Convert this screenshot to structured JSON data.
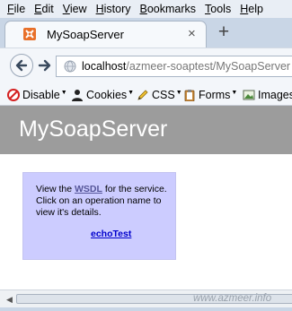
{
  "menu": {
    "file_rest": "ile",
    "edit_rest": "dit",
    "view_rest": "iew",
    "history_rest": "istory",
    "bookmarks_rest": "ookmarks",
    "tools_rest": "ools",
    "help_rest": "elp"
  },
  "tab": {
    "title": "MySoapServer",
    "close_glyph": "×"
  },
  "newtab_glyph": "+",
  "address": {
    "host": "localhost",
    "path": "/azmeer-soaptest/MySoapServer"
  },
  "devtoolbar": {
    "disable_label": "Disable",
    "cookies_label": "Cookies",
    "css_label": "CSS",
    "forms_label": "Forms",
    "images_label": "Images"
  },
  "page": {
    "title": "MySoapServer",
    "intro_prefix": "View the ",
    "wsdl_link": "WSDL",
    "intro_suffix": " for the service.",
    "line2": "Click on an operation name to",
    "line3": "view it's details.",
    "operation": "echoTest"
  },
  "watermark": "www.azmeer.info",
  "colors": {
    "header_band": "#9c9c9c",
    "info_box": "#ccccff",
    "link": "#0000cc"
  }
}
